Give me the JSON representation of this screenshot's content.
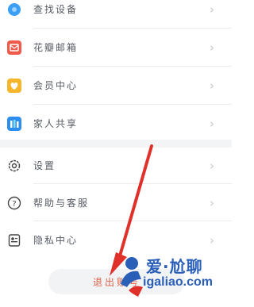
{
  "menu": {
    "find_device": "查找设备",
    "mailbox": "花瓣邮箱",
    "member_center": "会员中心",
    "family_share": "家人共享",
    "settings": "设置",
    "help": "帮助与客服",
    "privacy": "隐私中心"
  },
  "chevron": "›",
  "logout_label": "退出账号",
  "watermark": {
    "title": "爱·尬聊",
    "url": "igaliao.com"
  },
  "colors": {
    "accent_red": "#e0604a",
    "arrow_red": "#e0302a",
    "watermark_blue": "#2a5fb8"
  }
}
